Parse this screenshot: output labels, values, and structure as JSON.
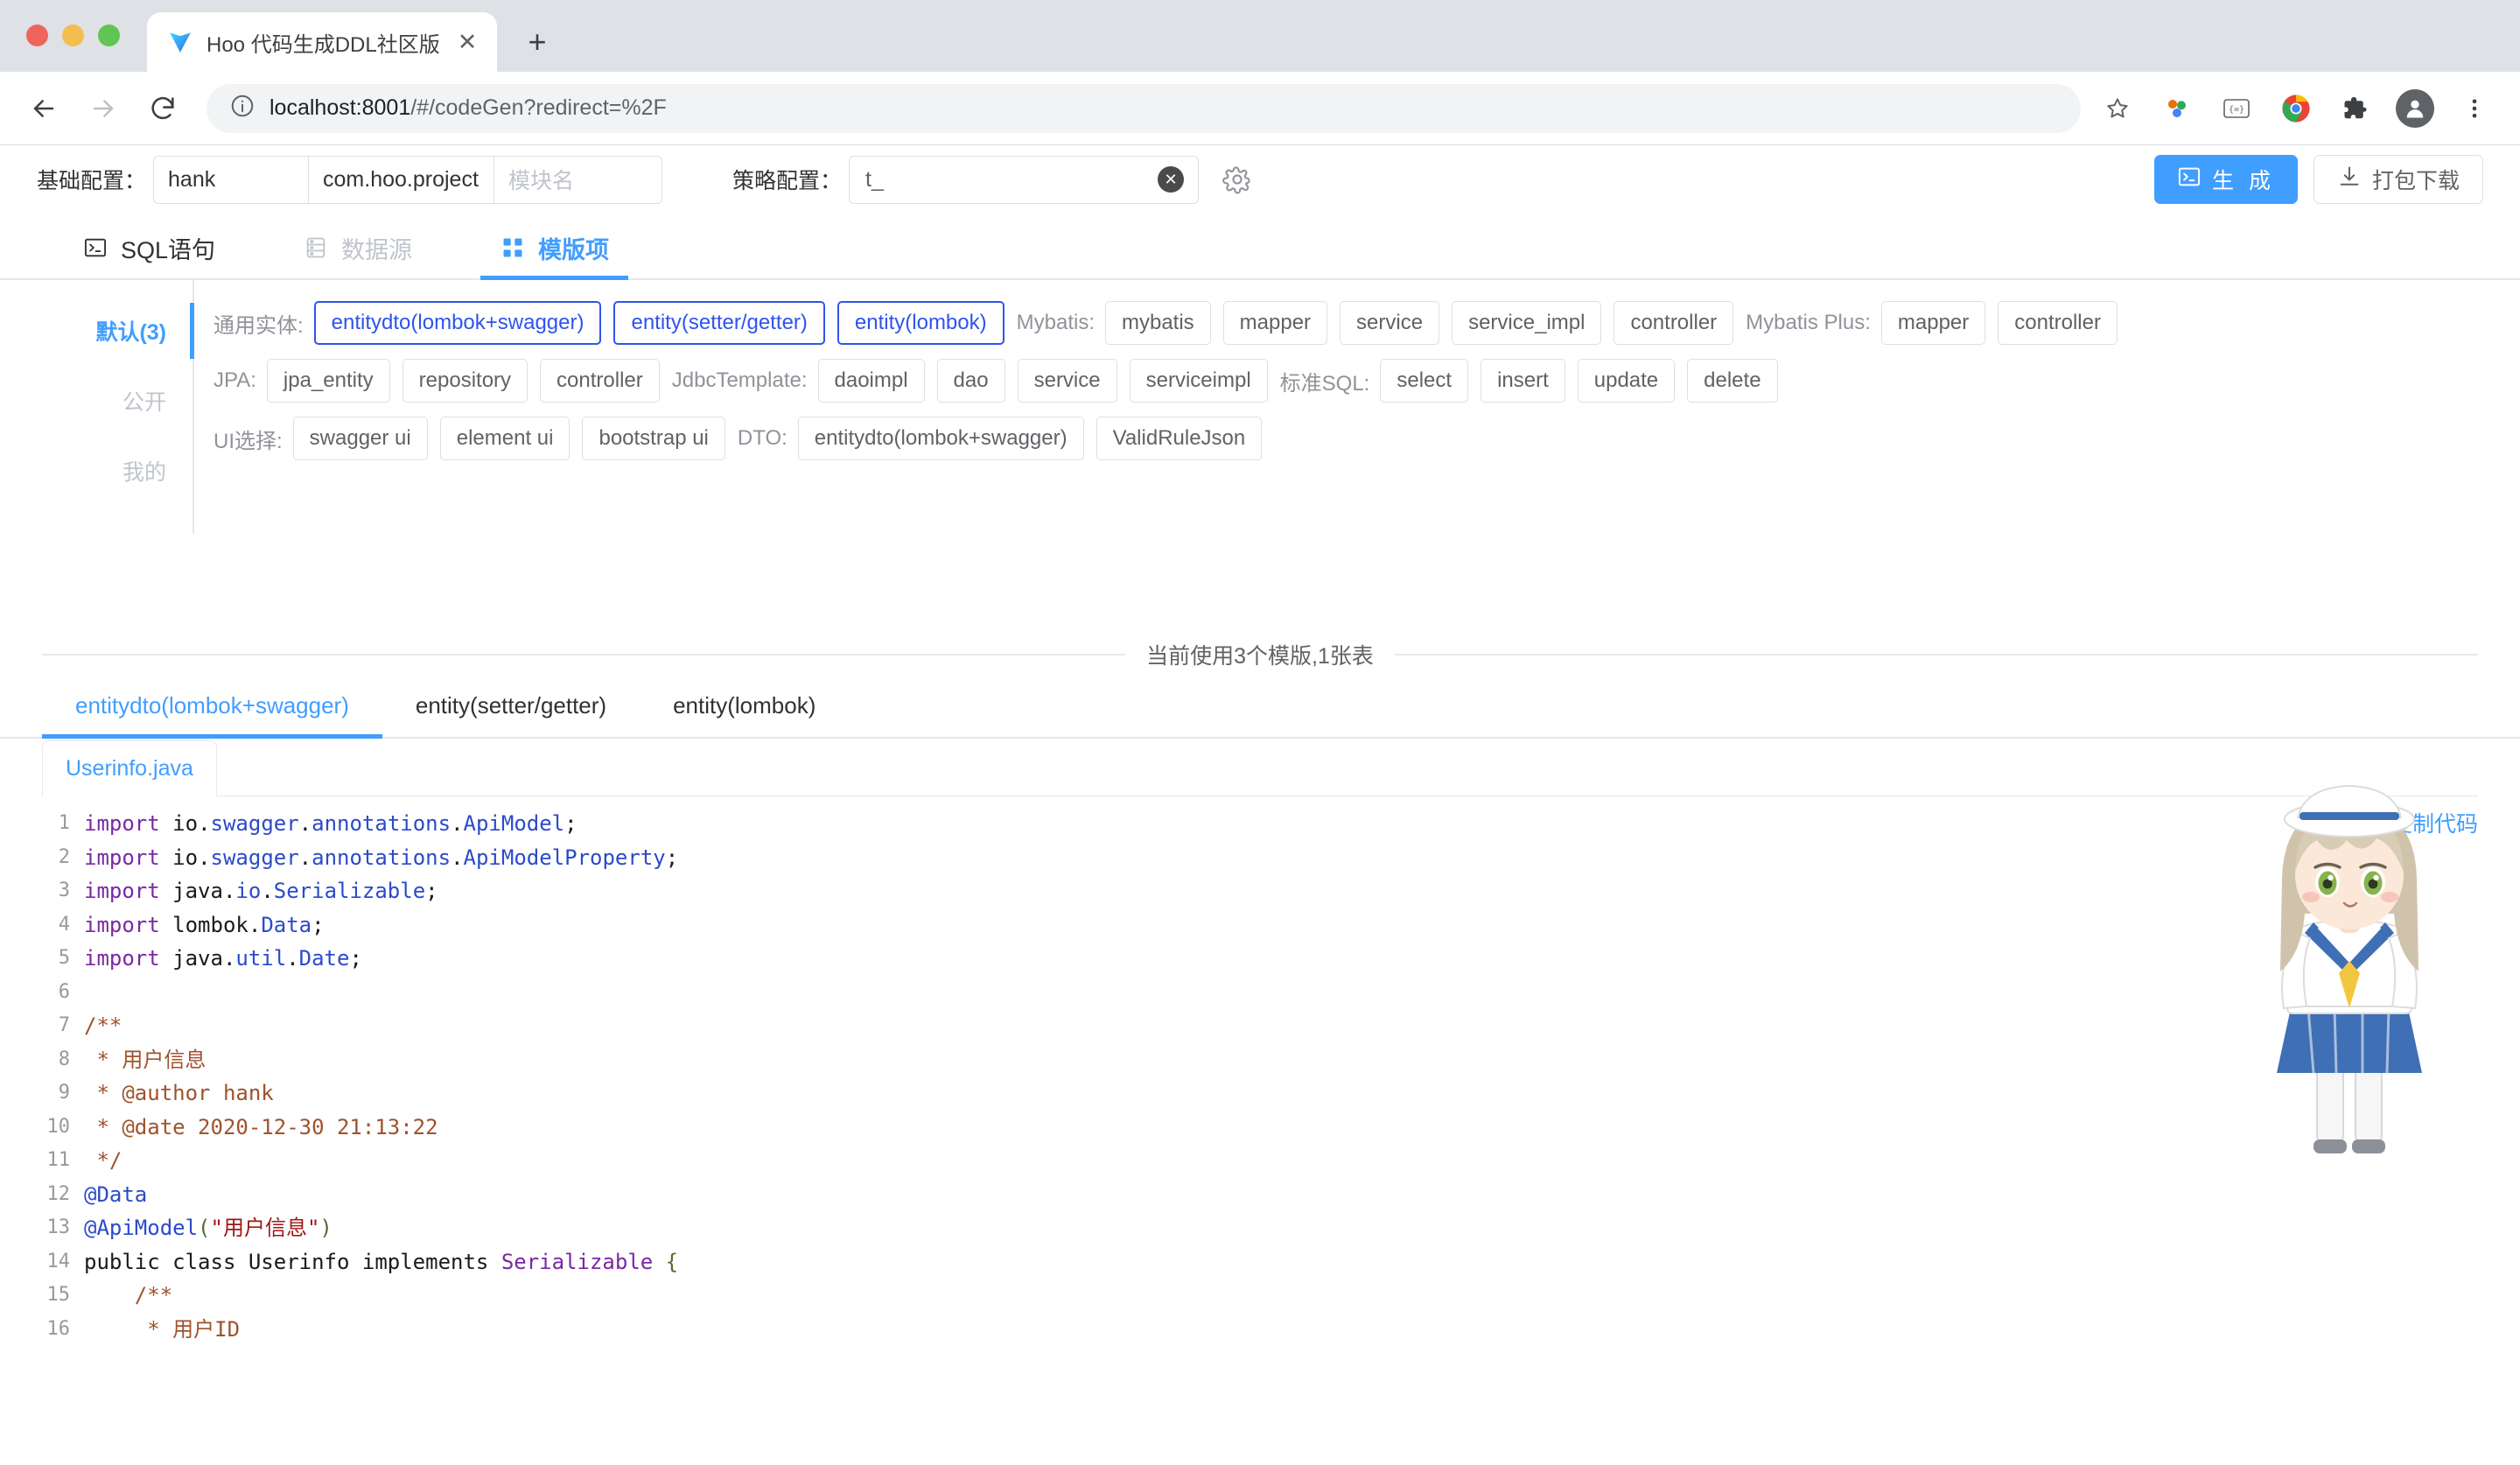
{
  "browser": {
    "tab": {
      "title": "Hoo 代码生成DDL社区版",
      "favicon": "vite-logo-icon",
      "close": "✕"
    },
    "new_tab_label": "+",
    "url": {
      "host": "localhost:8001",
      "path": "/#/codeGen?redirect=%2F"
    },
    "nav": {
      "back": "←",
      "forward": "→",
      "reload": "⟳"
    }
  },
  "config": {
    "base_label": "基础配置：",
    "author_value": "hank",
    "package_value": "com.hoo.project",
    "module_placeholder": "模块名",
    "strategy_label": "策略配置：",
    "strategy_value": "t_",
    "generate_button": "生 成",
    "download_button": "打包下载"
  },
  "top_tabs": [
    {
      "label": "SQL语句",
      "icon": "terminal-icon",
      "state": "normal"
    },
    {
      "label": "数据源",
      "icon": "database-icon",
      "state": "disabled"
    },
    {
      "label": "模版项",
      "icon": "grid-icon",
      "state": "active"
    }
  ],
  "template_side": [
    {
      "label": "默认(3)",
      "active": true
    },
    {
      "label": "公开",
      "active": false
    },
    {
      "label": "我的",
      "active": false
    }
  ],
  "template_groups": [
    {
      "row": 1,
      "groups": [
        {
          "label": "通用实体:",
          "chips": [
            {
              "label": "entitydto(lombok+swagger)",
              "selected": true
            },
            {
              "label": "entity(setter/getter)",
              "selected": true
            },
            {
              "label": "entity(lombok)",
              "selected": true
            }
          ]
        },
        {
          "label": "Mybatis:",
          "chips": [
            {
              "label": "mybatis",
              "selected": false
            },
            {
              "label": "mapper",
              "selected": false
            },
            {
              "label": "service",
              "selected": false
            },
            {
              "label": "service_impl",
              "selected": false
            },
            {
              "label": "controller",
              "selected": false
            }
          ]
        },
        {
          "label": "Mybatis Plus:",
          "chips": [
            {
              "label": "mapper",
              "selected": false
            },
            {
              "label": "controller",
              "selected": false
            }
          ]
        }
      ]
    },
    {
      "row": 2,
      "groups": [
        {
          "label": "JPA:",
          "chips": [
            {
              "label": "jpa_entity",
              "selected": false
            },
            {
              "label": "repository",
              "selected": false
            },
            {
              "label": "controller",
              "selected": false
            }
          ]
        },
        {
          "label": "JdbcTemplate:",
          "chips": [
            {
              "label": "daoimpl",
              "selected": false
            },
            {
              "label": "dao",
              "selected": false
            },
            {
              "label": "service",
              "selected": false
            },
            {
              "label": "serviceimpl",
              "selected": false
            }
          ]
        },
        {
          "label": "标准SQL:",
          "chips": [
            {
              "label": "select",
              "selected": false
            },
            {
              "label": "insert",
              "selected": false
            },
            {
              "label": "update",
              "selected": false
            },
            {
              "label": "delete",
              "selected": false
            }
          ]
        }
      ]
    },
    {
      "row": 3,
      "groups": [
        {
          "label": "UI选择:",
          "chips": [
            {
              "label": "swagger ui",
              "selected": false
            },
            {
              "label": "element ui",
              "selected": false
            },
            {
              "label": "bootstrap ui",
              "selected": false
            }
          ]
        },
        {
          "label": "DTO:",
          "chips": [
            {
              "label": "entitydto(lombok+swagger)",
              "selected": false
            },
            {
              "label": "ValidRuleJson",
              "selected": false
            }
          ]
        }
      ]
    }
  ],
  "status": {
    "usage_text": "当前使用3个模版,1张表"
  },
  "code_tabs": [
    {
      "label": "entitydto(lombok+swagger)",
      "active": true
    },
    {
      "label": "entity(setter/getter)",
      "active": false
    },
    {
      "label": "entity(lombok)",
      "active": false
    }
  ],
  "code_panel": {
    "file_tab": "Userinfo.java",
    "copy_link": "复制代码",
    "mascot": "anime-girl-mascot",
    "lines": [
      {
        "n": 1,
        "tokens": [
          {
            "t": "import ",
            "c": "kw"
          },
          {
            "t": "io",
            "c": "pl"
          },
          {
            "t": ".",
            "c": "pl"
          },
          {
            "t": "swagger",
            "c": "ty"
          },
          {
            "t": ".",
            "c": "pl"
          },
          {
            "t": "annotations",
            "c": "ty"
          },
          {
            "t": ".",
            "c": "pl"
          },
          {
            "t": "ApiModel",
            "c": "ty"
          },
          {
            "t": ";",
            "c": "pl"
          }
        ]
      },
      {
        "n": 2,
        "tokens": [
          {
            "t": "import ",
            "c": "kw"
          },
          {
            "t": "io",
            "c": "pl"
          },
          {
            "t": ".",
            "c": "pl"
          },
          {
            "t": "swagger",
            "c": "ty"
          },
          {
            "t": ".",
            "c": "pl"
          },
          {
            "t": "annotations",
            "c": "ty"
          },
          {
            "t": ".",
            "c": "pl"
          },
          {
            "t": "ApiModelProperty",
            "c": "ty"
          },
          {
            "t": ";",
            "c": "pl"
          }
        ]
      },
      {
        "n": 3,
        "tokens": [
          {
            "t": "import ",
            "c": "kw"
          },
          {
            "t": "java",
            "c": "pl"
          },
          {
            "t": ".",
            "c": "pl"
          },
          {
            "t": "io",
            "c": "ty"
          },
          {
            "t": ".",
            "c": "pl"
          },
          {
            "t": "Serializable",
            "c": "ty"
          },
          {
            "t": ";",
            "c": "pl"
          }
        ]
      },
      {
        "n": 4,
        "tokens": [
          {
            "t": "import ",
            "c": "kw"
          },
          {
            "t": "lombok",
            "c": "pl"
          },
          {
            "t": ".",
            "c": "pl"
          },
          {
            "t": "Data",
            "c": "ty"
          },
          {
            "t": ";",
            "c": "pl"
          }
        ]
      },
      {
        "n": 5,
        "tokens": [
          {
            "t": "import ",
            "c": "kw"
          },
          {
            "t": "java",
            "c": "pl"
          },
          {
            "t": ".",
            "c": "pl"
          },
          {
            "t": "util",
            "c": "ty"
          },
          {
            "t": ".",
            "c": "pl"
          },
          {
            "t": "Date",
            "c": "ty"
          },
          {
            "t": ";",
            "c": "pl"
          }
        ]
      },
      {
        "n": 6,
        "tokens": [
          {
            "t": "",
            "c": "pl"
          }
        ]
      },
      {
        "n": 7,
        "tokens": [
          {
            "t": "/**",
            "c": "cm"
          }
        ]
      },
      {
        "n": 8,
        "tokens": [
          {
            "t": " * 用户信息",
            "c": "cm"
          }
        ]
      },
      {
        "n": 9,
        "tokens": [
          {
            "t": " * @author hank",
            "c": "cm"
          }
        ]
      },
      {
        "n": 10,
        "tokens": [
          {
            "t": " * @date 2020-12-30 21:13:22",
            "c": "cm"
          }
        ]
      },
      {
        "n": 11,
        "tokens": [
          {
            "t": " */",
            "c": "cm"
          }
        ]
      },
      {
        "n": 12,
        "tokens": [
          {
            "t": "@Data",
            "c": "an"
          }
        ]
      },
      {
        "n": 13,
        "tokens": [
          {
            "t": "@ApiModel",
            "c": "an"
          },
          {
            "t": "(",
            "c": "br"
          },
          {
            "t": "\"用户信息\"",
            "c": "st"
          },
          {
            "t": ")",
            "c": "br"
          }
        ]
      },
      {
        "n": 14,
        "tokens": [
          {
            "t": "public class Userinfo implements ",
            "c": "pl"
          },
          {
            "t": "Serializable",
            "c": "cls"
          },
          {
            "t": " {",
            "c": "br"
          }
        ]
      },
      {
        "n": 15,
        "tokens": [
          {
            "t": "    /**",
            "c": "cm"
          }
        ]
      },
      {
        "n": 16,
        "tokens": [
          {
            "t": "     * 用户ID",
            "c": "cm"
          }
        ]
      }
    ]
  },
  "colors": {
    "accent": "#409eff",
    "chip_selected": "#2f54eb",
    "comment": "#a0522d",
    "keyword": "#7a28a3",
    "type": "#2b4acb",
    "string": "#a31515"
  }
}
